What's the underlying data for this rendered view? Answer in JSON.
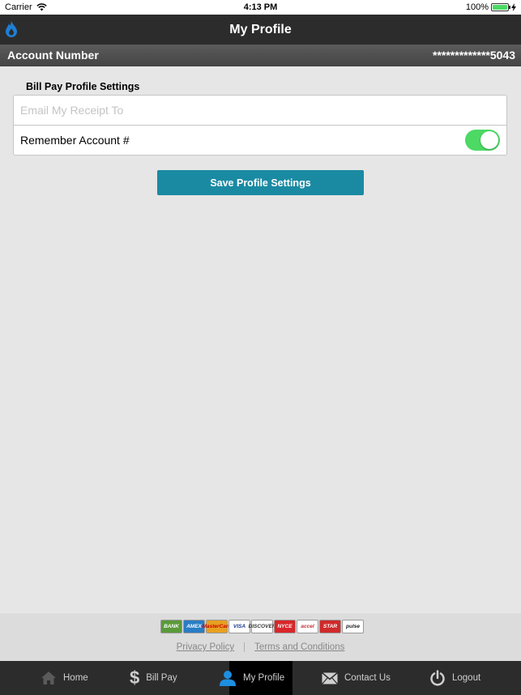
{
  "status_bar": {
    "carrier": "Carrier",
    "time": "4:13 PM",
    "battery": "100%"
  },
  "nav": {
    "title": "My Profile"
  },
  "account": {
    "label": "Account Number",
    "value": "*************5043"
  },
  "settings": {
    "section_title": "Bill Pay Profile Settings",
    "email_placeholder": "Email My Receipt To",
    "email_value": "",
    "remember_label": "Remember Account #",
    "remember_enabled": true,
    "save_label": "Save Profile Settings"
  },
  "footer": {
    "payment_methods": [
      {
        "name": "BANK",
        "icon": "bank-icon",
        "bg": "#5a9a3a",
        "fg": "#fff"
      },
      {
        "name": "AMEX",
        "icon": "amex-icon",
        "bg": "#2a7dc4",
        "fg": "#fff"
      },
      {
        "name": "MasterCard",
        "icon": "mastercard-icon",
        "bg": "#e8a020",
        "fg": "#c00"
      },
      {
        "name": "VISA",
        "icon": "visa-icon",
        "bg": "#ffffff",
        "fg": "#1a3a8a"
      },
      {
        "name": "DISCOVER",
        "icon": "discover-icon",
        "bg": "#ffffff",
        "fg": "#333"
      },
      {
        "name": "NYCE",
        "icon": "nyce-icon",
        "bg": "#d8262a",
        "fg": "#fff"
      },
      {
        "name": "accel",
        "icon": "accel-icon",
        "bg": "#ffffff",
        "fg": "#c43030"
      },
      {
        "name": "STAR",
        "icon": "star-icon",
        "bg": "#d02a2a",
        "fg": "#fff"
      },
      {
        "name": "pulse",
        "icon": "pulse-icon",
        "bg": "#ffffff",
        "fg": "#222"
      }
    ],
    "privacy_policy": "Privacy Policy",
    "terms": "Terms and Conditions"
  },
  "tabs": [
    {
      "label": "Home",
      "icon": "home-icon",
      "state": "disabled"
    },
    {
      "label": "Bill Pay",
      "icon": "dollar-icon",
      "state": "normal"
    },
    {
      "label": "My Profile",
      "icon": "person-icon",
      "state": "active"
    },
    {
      "label": "Contact Us",
      "icon": "envelope-icon",
      "state": "normal"
    },
    {
      "label": "Logout",
      "icon": "power-icon",
      "state": "normal"
    }
  ],
  "colors": {
    "accent": "#1a8aa3",
    "toggle_on": "#4cd964",
    "bar_dark": "#2c2c2c",
    "person_icon": "#1e8ee0"
  }
}
